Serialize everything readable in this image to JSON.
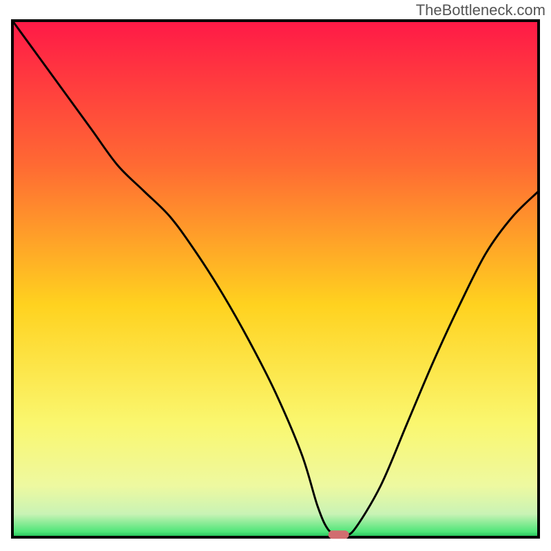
{
  "watermark": "TheBottleneck.com",
  "chart_data": {
    "type": "line",
    "title": "",
    "xlabel": "",
    "ylabel": "",
    "xlim": [
      0,
      100
    ],
    "ylim": [
      0,
      100
    ],
    "x": [
      0,
      5,
      10,
      15,
      20,
      25,
      30,
      35,
      40,
      45,
      50,
      55,
      58,
      60,
      62,
      63,
      65,
      70,
      75,
      80,
      85,
      90,
      95,
      100
    ],
    "values": [
      100,
      93,
      86,
      79,
      72,
      67,
      62,
      55,
      47,
      38,
      28,
      16,
      6,
      1.5,
      0.5,
      0.5,
      1.5,
      10,
      22,
      34,
      45,
      55,
      62,
      67
    ],
    "marker": {
      "x": 62,
      "y": 0.5,
      "color": "#d16d70",
      "shape": "pill"
    },
    "gradient_stops": [
      {
        "offset": 0.0,
        "color": "#ff1947"
      },
      {
        "offset": 0.28,
        "color": "#ff6a33"
      },
      {
        "offset": 0.55,
        "color": "#ffd21f"
      },
      {
        "offset": 0.78,
        "color": "#faf76f"
      },
      {
        "offset": 0.9,
        "color": "#eef9a0"
      },
      {
        "offset": 0.955,
        "color": "#c9f3b5"
      },
      {
        "offset": 0.99,
        "color": "#4de578"
      },
      {
        "offset": 1.0,
        "color": "#1db954"
      }
    ],
    "frame_color": "#000000",
    "line_color": "#000000"
  }
}
